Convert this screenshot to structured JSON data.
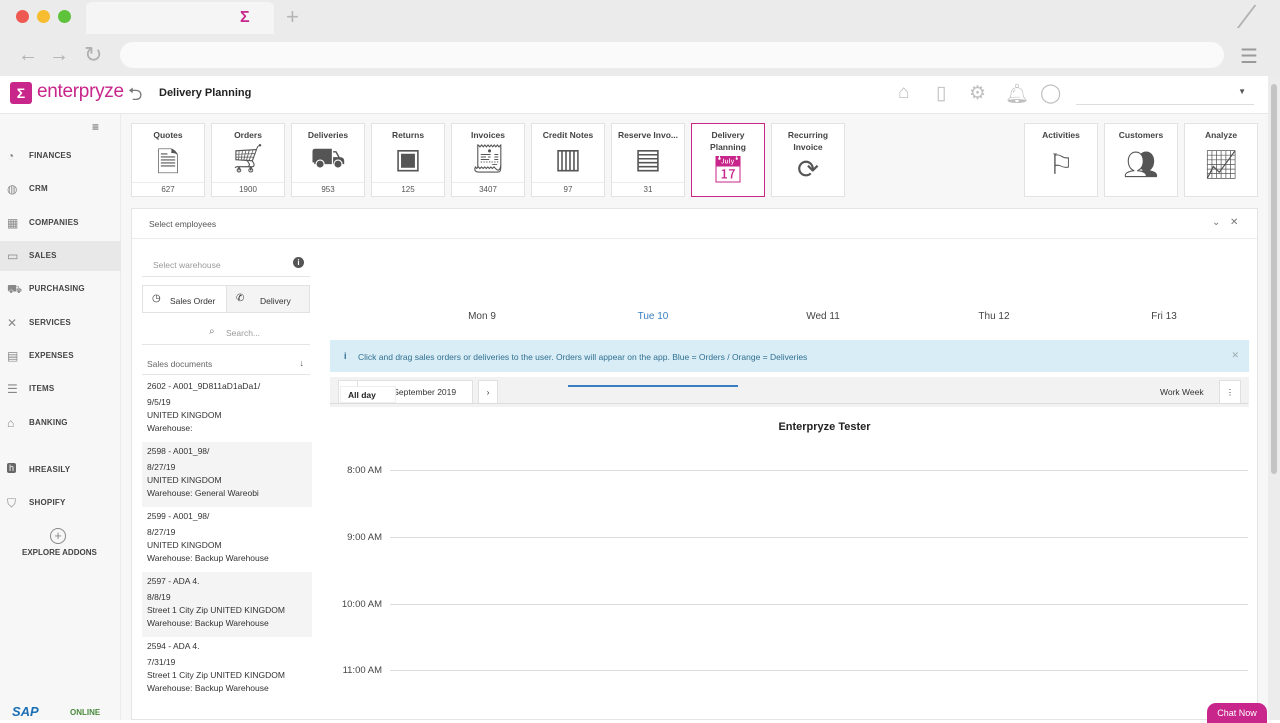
{
  "browser": {
    "tab_logo": "Σ",
    "new_tab": "+",
    "back": "←",
    "forward": "→",
    "reload": "↻",
    "menu": "☰"
  },
  "app": {
    "brand": "enterpryze",
    "brand_mark": "Σ",
    "title": "Delivery Planning",
    "accent_color": "#c8268a"
  },
  "sidebar": {
    "items": [
      {
        "label": "FINANCES",
        "icon": "piggy-bank-icon"
      },
      {
        "label": "CRM",
        "icon": "globe-icon"
      },
      {
        "label": "COMPANIES",
        "icon": "building-icon"
      },
      {
        "label": "SALES",
        "icon": "money-icon"
      },
      {
        "label": "PURCHASING",
        "icon": "cart-icon"
      },
      {
        "label": "SERVICES",
        "icon": "tools-icon"
      },
      {
        "label": "EXPENSES",
        "icon": "receipt-icon"
      },
      {
        "label": "ITEMS",
        "icon": "list-icon"
      },
      {
        "label": "BANKING",
        "icon": "bank-icon"
      },
      {
        "label": "HREASILY",
        "icon": "hreasily-icon"
      },
      {
        "label": "SHOPIFY",
        "icon": "shopify-icon"
      }
    ],
    "explore": "EXPLORE ADDONS",
    "sap": "SAP",
    "sap_online": "ONLINE"
  },
  "tiles": [
    {
      "label": "Quotes",
      "count": "627",
      "icon": "document-icon"
    },
    {
      "label": "Orders",
      "count": "1900",
      "icon": "cart-icon"
    },
    {
      "label": "Deliveries",
      "count": "953",
      "icon": "truck-icon"
    },
    {
      "label": "Returns",
      "count": "125",
      "icon": "box-return-icon"
    },
    {
      "label": "Invoices",
      "count": "3407",
      "icon": "invoice-icon"
    },
    {
      "label": "Credit Notes",
      "count": "97",
      "icon": "credit-note-icon"
    },
    {
      "label": "Reserve Invo...",
      "count": "31",
      "icon": "reserve-invoice-icon"
    },
    {
      "label": "Delivery\nPlanning",
      "icon": "calendar-check-icon"
    },
    {
      "label": "Recurring\nInvoice",
      "icon": "recurring-icon"
    }
  ],
  "right_tiles": [
    {
      "label": "Activities",
      "icon": "flag-icon"
    },
    {
      "label": "Customers",
      "icon": "customers-icon"
    },
    {
      "label": "Analyze",
      "icon": "chart-icon"
    }
  ],
  "planner": {
    "select_employees": "Select employees",
    "warehouse_placeholder": "Select warehouse",
    "sales_order": "Sales Order",
    "delivery": "Delivery",
    "search_placeholder": "Search...",
    "docs_header": "Sales documents",
    "info": "Click and drag sales orders or deliveries to the user. Orders will appear on the app. Blue = Orders / Orange = Deliveries",
    "date_range": "9-13 September 2019",
    "view": "Work Week",
    "owner": "Enterpryze Tester",
    "days": [
      "Mon 9",
      "Tue 10",
      "Wed 11",
      "Thu 12",
      "Fri 13"
    ],
    "all_day": "All day",
    "hours": [
      "8:00 AM",
      "9:00 AM",
      "10:00 AM",
      "11:00 AM"
    ],
    "chat": "Chat Now"
  },
  "documents": [
    {
      "id": "2602 - A001_9D811aD1aDa1/",
      "date": "9/5/19",
      "address": "UNITED KINGDOM",
      "warehouse": "Warehouse:"
    },
    {
      "id": "2598 - A001_98/",
      "date": "8/27/19",
      "address": "UNITED KINGDOM",
      "warehouse": "Warehouse: General Wareobi"
    },
    {
      "id": "2599 - A001_98/",
      "date": "8/27/19",
      "address": "UNITED KINGDOM",
      "warehouse": "Warehouse: Backup Warehouse"
    },
    {
      "id": "2597 - ADA 4.",
      "date": "8/8/19",
      "address": "Street 1 City Zip UNITED KINGDOM",
      "warehouse": "Warehouse: Backup Warehouse"
    },
    {
      "id": "2594 - ADA 4.",
      "date": "7/31/19",
      "address": "Street 1 City Zip UNITED KINGDOM",
      "warehouse": "Warehouse: Backup Warehouse"
    }
  ]
}
